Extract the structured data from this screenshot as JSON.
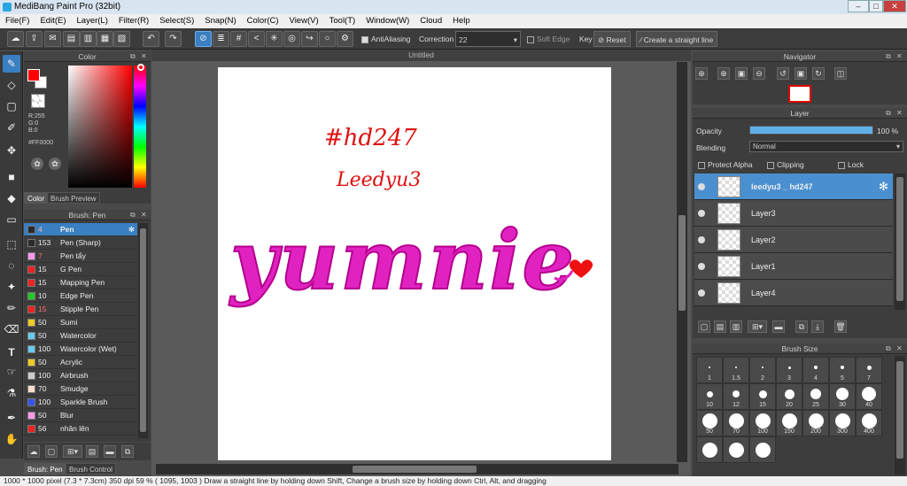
{
  "window": {
    "title": "MediBang Paint Pro (32bit)",
    "minimize": "–",
    "maximize": "□",
    "close": "✕"
  },
  "menu": [
    "File(F)",
    "Edit(E)",
    "Layer(L)",
    "Filter(R)",
    "Select(S)",
    "Snap(N)",
    "Color(C)",
    "View(V)",
    "Tool(T)",
    "Window(W)",
    "Cloud",
    "Help"
  ],
  "toolbar": {
    "antialiasing": "AntiAliasing",
    "correction_label": "Correction",
    "correction_value": "22",
    "soft_edge": "Soft Edge",
    "key": "Key",
    "reset": "Reset",
    "create_line": "Create a straight line"
  },
  "color_panel": {
    "title": "Color",
    "r": "R:255",
    "g": "G:0",
    "b": "B:0",
    "hex": "#FF0000",
    "main_color": "#ff0000",
    "tabs": [
      "Color",
      "Brush Preview"
    ]
  },
  "brush_panel": {
    "title": "Brush: Pen",
    "items": [
      {
        "size": "4",
        "name": "Pen",
        "color": "#2a2a2a"
      },
      {
        "size": "153",
        "name": "Pen (Sharp)",
        "color": "#2a2a2a"
      },
      {
        "size": "7",
        "name": "Pen tẩy",
        "color": "#ff99ee"
      },
      {
        "size": "15",
        "name": "G Pen",
        "color": "#ee2222"
      },
      {
        "size": "15",
        "name": "Mapping Pen",
        "color": "#ee2222"
      },
      {
        "size": "10",
        "name": "Edge Pen",
        "color": "#22cc22"
      },
      {
        "size": "15",
        "name": "Stipple Pen",
        "color": "#ee2222"
      },
      {
        "size": "50",
        "name": "Sumi",
        "color": "#eecc22"
      },
      {
        "size": "50",
        "name": "Watercolor",
        "color": "#66ccee"
      },
      {
        "size": "100",
        "name": "Watercolor (Wet)",
        "color": "#66ccee"
      },
      {
        "size": "50",
        "name": "Acrylic",
        "color": "#eecc22"
      },
      {
        "size": "100",
        "name": "Airbrush",
        "color": "#cccccc"
      },
      {
        "size": "70",
        "name": "Smudge",
        "color": "#ffddcc"
      },
      {
        "size": "100",
        "name": "Sparkle Brush",
        "color": "#3355ee"
      },
      {
        "size": "50",
        "name": "Blur",
        "color": "#ff99ee"
      },
      {
        "size": "56",
        "name": "nhân lên",
        "color": "#ee2222"
      }
    ],
    "tabs": [
      "Brush: Pen",
      "Brush Control"
    ]
  },
  "document": {
    "tab": "Untitled"
  },
  "canvas_text": {
    "line1": "#hd247",
    "line2": "Leedyu3",
    "main": "yumnie"
  },
  "navigator": {
    "title": "Navigator"
  },
  "layer_panel": {
    "title": "Layer",
    "opacity_label": "Opacity",
    "opacity_value": "100 %",
    "opacity_fraction": 1.0,
    "blending_label": "Blending",
    "blending_value": "Normal",
    "protect_alpha": "Protect Alpha",
    "clipping": "Clipping",
    "lock": "Lock",
    "layers": [
      "leedyu3 _ hd247",
      "Layer3",
      "Layer2",
      "Layer1",
      "Layer4"
    ]
  },
  "brush_size": {
    "title": "Brush Size",
    "sizes": [
      "1",
      "1.5",
      "2",
      "3",
      "4",
      "5",
      "7",
      "10",
      "12",
      "15",
      "20",
      "25",
      "30",
      "40",
      "50",
      "70",
      "100",
      "150",
      "200",
      "300",
      "400",
      "",
      "",
      ""
    ]
  },
  "status": "1000 * 1000 pixel  (7.3 * 7.3cm)  350 dpi  59 %  ( 1095, 1003 )  Draw a straight line by holding down Shift, Change a brush size by holding down Ctrl, Alt, and dragging"
}
